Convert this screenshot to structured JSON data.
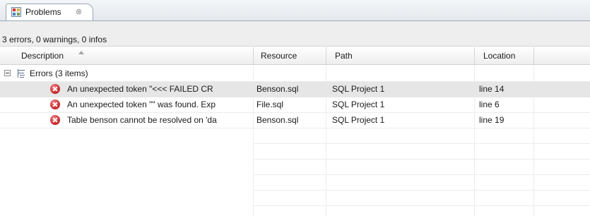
{
  "tab": {
    "label": "Problems",
    "close_glyph": "⊗",
    "icon": "problems-view-icon"
  },
  "summary": "3 errors, 0 warnings, 0 infos",
  "columns": [
    "Description",
    "Resource",
    "Path",
    "Location"
  ],
  "sort": {
    "column": "Description",
    "direction": "ascending"
  },
  "group": {
    "label": "Errors (3 items)",
    "expanded": true,
    "icon": "error-group-icon"
  },
  "rows": [
    {
      "description": "An unexpected token \"<<< FAILED CR",
      "resource": "Benson.sql",
      "path": "SQL Project 1",
      "location": "line 14",
      "selected": true
    },
    {
      "description": "An unexpected token \"\" was found. Exp",
      "resource": "File.sql",
      "path": "SQL Project 1",
      "location": "line 6",
      "selected": false
    },
    {
      "description": "Table benson cannot be resolved on 'da",
      "resource": "Benson.sql",
      "path": "SQL Project 1",
      "location": "line 19",
      "selected": false
    }
  ],
  "colors": {
    "error": "#c8262b",
    "selection": "#e6e6e6",
    "summary_bg": "#eeeeee",
    "border": "#9aa7b4"
  }
}
